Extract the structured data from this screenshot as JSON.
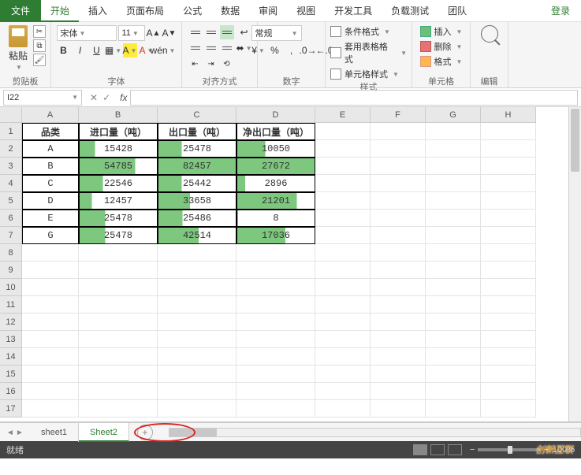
{
  "menu": {
    "file": "文件",
    "tabs": [
      "开始",
      "插入",
      "页面布局",
      "公式",
      "数据",
      "审阅",
      "视图",
      "开发工具",
      "负载测试",
      "团队"
    ],
    "active": 0,
    "login": "登录"
  },
  "ribbon": {
    "clipboard": {
      "paste": "粘贴",
      "label": "剪贴板"
    },
    "font": {
      "name": "宋体",
      "size": "11",
      "bold": "B",
      "italic": "I",
      "underline": "U",
      "label": "字体"
    },
    "align": {
      "label": "对齐方式"
    },
    "number": {
      "format": "常规",
      "label": "数字"
    },
    "styles": {
      "cond": "条件格式",
      "table": "套用表格格式",
      "cell": "单元格样式",
      "label": "样式"
    },
    "cells": {
      "insert": "插入",
      "delete": "删除",
      "format": "格式",
      "label": "单元格"
    },
    "edit": {
      "label": "编辑"
    }
  },
  "namebox": "I22",
  "cols": [
    "A",
    "B",
    "C",
    "D",
    "E",
    "F",
    "G",
    "H"
  ],
  "headers": [
    "品类",
    "进口量（吨）",
    "出口量（吨）",
    "净出口量（吨）"
  ],
  "rows": [
    {
      "cat": "A",
      "imp": 15428,
      "exp": 25478,
      "net": 10050,
      "pi": 20,
      "pe": 30,
      "pn": 36
    },
    {
      "cat": "B",
      "imp": 54785,
      "exp": 82457,
      "net": 27672,
      "pi": 72,
      "pe": 100,
      "pn": 100
    },
    {
      "cat": "C",
      "imp": 22546,
      "exp": 25442,
      "net": 2896,
      "pi": 30,
      "pe": 30,
      "pn": 10
    },
    {
      "cat": "D",
      "imp": 12457,
      "exp": 33658,
      "net": 21201,
      "pi": 16,
      "pe": 41,
      "pn": 77
    },
    {
      "cat": "E",
      "imp": 25478,
      "exp": 25486,
      "net": 8,
      "pi": 33,
      "pe": 31,
      "pn": 1
    },
    {
      "cat": "G",
      "imp": 25478,
      "exp": 42514,
      "net": 17036,
      "pi": 33,
      "pe": 52,
      "pn": 62
    }
  ],
  "sheets": {
    "s1": "sheet1",
    "s2": "Sheet2"
  },
  "status": {
    "ready": "就绪",
    "zoom": "100%"
  },
  "watermark": "创新互联"
}
